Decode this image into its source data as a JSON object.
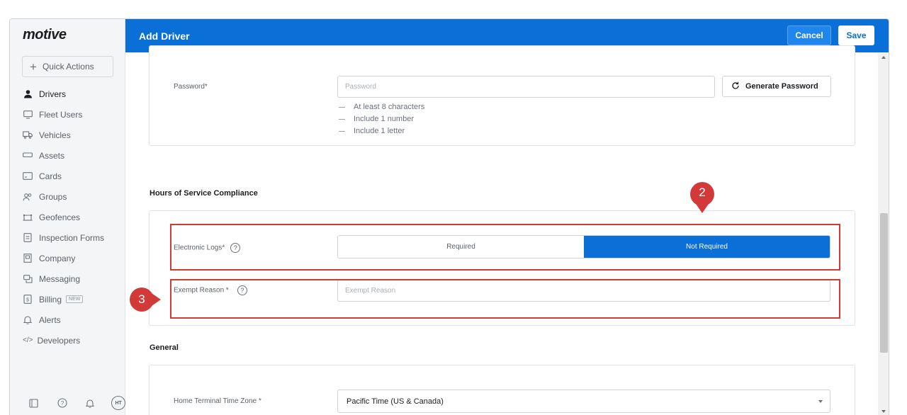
{
  "app": {
    "logo": "motive",
    "page_title": "Add Driver"
  },
  "header": {
    "cancel_label": "Cancel",
    "save_label": "Save"
  },
  "sidebar": {
    "quick_actions": "Quick Actions",
    "items": [
      {
        "label": "Drivers",
        "icon": "driver-icon",
        "active": true
      },
      {
        "label": "Fleet Users",
        "icon": "monitor-icon"
      },
      {
        "label": "Vehicles",
        "icon": "truck-icon"
      },
      {
        "label": "Assets",
        "icon": "trailer-icon"
      },
      {
        "label": "Cards",
        "icon": "card-icon"
      },
      {
        "label": "Groups",
        "icon": "groups-icon"
      },
      {
        "label": "Geofences",
        "icon": "geofence-icon"
      },
      {
        "label": "Inspection Forms",
        "icon": "form-icon"
      },
      {
        "label": "Company",
        "icon": "building-icon"
      },
      {
        "label": "Messaging",
        "icon": "message-icon"
      },
      {
        "label": "Billing",
        "icon": "billing-icon",
        "badge": "NEW"
      },
      {
        "label": "Alerts",
        "icon": "bell-icon"
      },
      {
        "label": "Developers",
        "icon": "code-icon"
      }
    ],
    "footer": {
      "avatar_initials": "HT"
    }
  },
  "password": {
    "label": "Password*",
    "placeholder": "Password",
    "generate_label": "Generate Password",
    "rules": [
      "At least 8 characters",
      "Include 1 number",
      "Include 1 letter"
    ]
  },
  "hos": {
    "heading": "Hours of Service Compliance",
    "eld_label": "Electronic Logs*",
    "options": [
      "Required",
      "Not Required"
    ],
    "selected": "Not Required",
    "exempt_label": "Exempt Reason *",
    "exempt_placeholder": "Exempt Reason"
  },
  "general": {
    "heading": "General",
    "tz_label": "Home Terminal Time Zone *",
    "tz_value": "Pacific Time (US & Canada)"
  },
  "annotations": {
    "marker_2": "2",
    "marker_3": "3",
    "color": "#d23a3a"
  },
  "help_glyph": "?"
}
